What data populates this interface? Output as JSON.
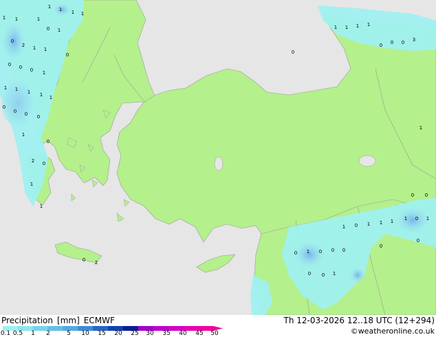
{
  "map": {
    "colors": {
      "sea": "#e6e6e6",
      "land": "#b4f08c",
      "border": "#9a9a9a",
      "coast": "#9a9a9a"
    },
    "values": [
      "1",
      "1",
      "1",
      "1",
      "1",
      "1",
      "1",
      "0",
      "1",
      "0",
      "2",
      "1",
      "1",
      "0",
      "0",
      "0",
      "0",
      "1",
      "1",
      "1",
      "1",
      "1",
      "1",
      "0",
      "0",
      "0",
      "0",
      "1",
      "0",
      "2",
      "0",
      "1",
      "1",
      "0",
      "2",
      "0",
      "1",
      "1",
      "1",
      "1",
      "0",
      "0",
      "0",
      "3",
      "1",
      "0",
      "0",
      "1",
      "0",
      "1",
      "1",
      "0",
      "1",
      "1",
      "1",
      "0",
      "0",
      "1",
      "0",
      "0",
      "0",
      "0",
      "0",
      "0",
      "1"
    ]
  },
  "footer": {
    "title_parts": [
      "Precipitation",
      "[mm]",
      "ECMWF"
    ],
    "datetime": "Th 12-03-2026 12..18 UTC (12+294)",
    "credit": "©weatheronline.co.uk",
    "legend_ticks": [
      "0.1",
      "0.5",
      "1",
      "2",
      "5",
      "10",
      "15",
      "20",
      "25",
      "30",
      "35",
      "40",
      "45",
      "50"
    ],
    "legend_colors": [
      "#a0f0f0",
      "#8ce6f0",
      "#78d2eb",
      "#64bee6",
      "#50aae1",
      "#3c8cd7",
      "#2864c8",
      "#1440b4",
      "#0a1e96",
      "#a000c8",
      "#be00d2",
      "#d200c8",
      "#e600b4",
      "#f000a0"
    ]
  }
}
